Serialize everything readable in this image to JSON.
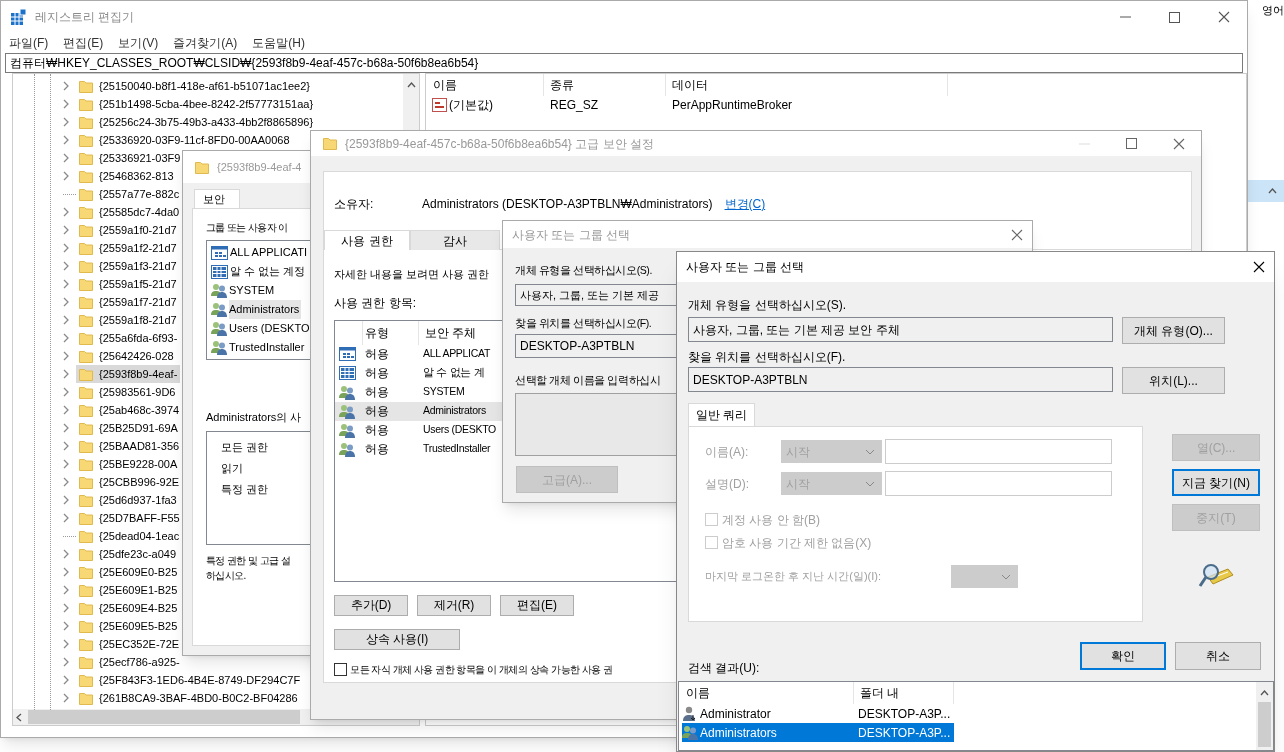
{
  "background_window": {
    "text": "영어"
  },
  "registry": {
    "title": "레지스트리 편집기",
    "menu": [
      "파일(F)",
      "편집(E)",
      "보기(V)",
      "즐겨찾기(A)",
      "도움말(H)"
    ],
    "address": "컴퓨터₩HKEY_CLASSES_ROOT₩CLSID₩{2593f8b9-4eaf-457c-b68a-50f6b8ea6b54}",
    "tree": [
      {
        "label": "{25150040-b8f1-418e-af61-b51071ac1ee2}",
        "expandable": true,
        "selected": false
      },
      {
        "label": "{251b1498-5cba-4bee-8242-2f57773151aa}",
        "expandable": true,
        "selected": false
      },
      {
        "label": "{25256c24-3b75-49b3-a433-4bb2f8865896}",
        "expandable": true,
        "selected": false
      },
      {
        "label": "{25336920-03F9-11cf-8FD0-00AA0068",
        "expandable": true,
        "selected": false
      },
      {
        "label": "{25336921-03F9",
        "expandable": true,
        "selected": false
      },
      {
        "label": "{25468362-813",
        "expandable": true,
        "selected": false
      },
      {
        "label": "{2557a77e-882c",
        "expandable": false,
        "selected": false
      },
      {
        "label": "{25585dc7-4da0",
        "expandable": true,
        "selected": false
      },
      {
        "label": "{2559a1f0-21d7",
        "expandable": true,
        "selected": false
      },
      {
        "label": "{2559a1f2-21d7",
        "expandable": true,
        "selected": false
      },
      {
        "label": "{2559a1f3-21d7",
        "expandable": true,
        "selected": false
      },
      {
        "label": "{2559a1f5-21d7",
        "expandable": true,
        "selected": false
      },
      {
        "label": "{2559a1f7-21d7",
        "expandable": true,
        "selected": false
      },
      {
        "label": "{2559a1f8-21d7",
        "expandable": true,
        "selected": false
      },
      {
        "label": "{255a6fda-6f93-",
        "expandable": true,
        "selected": false
      },
      {
        "label": "{25642426-028",
        "expandable": true,
        "selected": false
      },
      {
        "label": "{2593f8b9-4eaf-",
        "expandable": true,
        "selected": true
      },
      {
        "label": "{25983561-9D6",
        "expandable": true,
        "selected": false
      },
      {
        "label": "{25ab468c-3974",
        "expandable": true,
        "selected": false
      },
      {
        "label": "{25B25D91-69A",
        "expandable": true,
        "selected": false
      },
      {
        "label": "{25BAAD81-356",
        "expandable": true,
        "selected": false
      },
      {
        "label": "{25BE9228-00A",
        "expandable": true,
        "selected": false
      },
      {
        "label": "{25CBB996-92E",
        "expandable": true,
        "selected": false
      },
      {
        "label": "{25d6d937-1fa3",
        "expandable": true,
        "selected": false
      },
      {
        "label": "{25D7BAFF-F55",
        "expandable": true,
        "selected": false
      },
      {
        "label": "{25dead04-1eac",
        "expandable": false,
        "selected": false
      },
      {
        "label": "{25dfe23c-a049",
        "expandable": true,
        "selected": false
      },
      {
        "label": "{25E609E0-B25",
        "expandable": true,
        "selected": false
      },
      {
        "label": "{25E609E1-B25",
        "expandable": true,
        "selected": false
      },
      {
        "label": "{25E609E4-B25",
        "expandable": true,
        "selected": false
      },
      {
        "label": "{25E609E5-B25",
        "expandable": true,
        "selected": false
      },
      {
        "label": "{25EC352E-72E",
        "expandable": true,
        "selected": false
      },
      {
        "label": "{25ecf786-a925-",
        "expandable": true,
        "selected": false
      },
      {
        "label": "{25F843F3-1ED6-4B4E-8749-DF294C7F",
        "expandable": true,
        "selected": false
      },
      {
        "label": "{261B8CA9-3BAF-4BD0-B0C2-BF04286",
        "expandable": true,
        "selected": false
      }
    ],
    "values": {
      "columns": [
        "이름",
        "종류",
        "데이터"
      ],
      "rows": [
        {
          "name": "(기본값)",
          "type": "REG_SZ",
          "data": "PerAppRuntimeBroker"
        }
      ]
    }
  },
  "security_dialog": {
    "title": "{2593f8b9-4eaf-4",
    "tabs": [
      {
        "label": "보안",
        "selected": true
      }
    ],
    "groups_label": "그룹 또는 사용자 이",
    "principals": [
      {
        "name": "ALL APPLICATI",
        "kind": "package",
        "selected": false
      },
      {
        "name": "알 수 없는 계정",
        "kind": "unknown",
        "selected": false
      },
      {
        "name": "SYSTEM",
        "kind": "group",
        "selected": false
      },
      {
        "name": "Administrators",
        "kind": "group",
        "selected": true
      },
      {
        "name": "Users (DESKTO",
        "kind": "group",
        "selected": false
      },
      {
        "name": "TrustedInstaller",
        "kind": "group",
        "selected": false
      }
    ],
    "permissions_label": "Administrators의 사",
    "permissions": [
      "모든 권한",
      "읽기",
      "특정 권한"
    ],
    "note_lines": [
      "특정 권한 및 고급 설",
      "하십시오."
    ]
  },
  "advanced_dialog": {
    "title": "{2593f8b9-4eaf-457c-b68a-50f6b8ea6b54} 고급 보안 설정",
    "owner_label": "소유자:",
    "owner": "Administrators (DESKTOP-A3PTBLN₩Administrators)",
    "change_link": "변경(C)",
    "tabs": [
      {
        "label": "사용 권한",
        "selected": true
      },
      {
        "label": "감사",
        "selected": false
      }
    ],
    "hint": "자세한 내용을 보려면 사용 권한",
    "entries_label": "사용 권한 항목:",
    "columns": [
      "유형",
      "보안 주체"
    ],
    "entries": [
      {
        "type": "허용",
        "principal": "ALL APPLICAT",
        "kind": "package",
        "selected": false
      },
      {
        "type": "허용",
        "principal": "알 수 없는 계",
        "kind": "unknown",
        "selected": false
      },
      {
        "type": "허용",
        "principal": "SYSTEM",
        "kind": "group",
        "selected": false
      },
      {
        "type": "허용",
        "principal": "Administrators",
        "kind": "group",
        "selected": true
      },
      {
        "type": "허용",
        "principal": "Users (DESKTO",
        "kind": "group",
        "selected": false
      },
      {
        "type": "허용",
        "principal": "TrustedInstaller",
        "kind": "group",
        "selected": false
      }
    ],
    "buttons": [
      "추가(D)",
      "제거(R)",
      "편집(E)"
    ],
    "inherit_button": "상속 사용(I)",
    "inherit_checkbox": {
      "label": "모든 자식 개체 사용 권한 항목을 이 개체의 상속 가능한 사용 권",
      "checked": false
    }
  },
  "select_dialog_back": {
    "title": "사용자 또는 그룹 선택",
    "object_type_label": "개체 유형을 선택하십시오(S).",
    "object_type": "사용자, 그룹, 또는 기본 제공",
    "location_label": "찾을 위치를 선택하십시오(F).",
    "location": "DESKTOP-A3PTBLN",
    "names_label": "선택할 개체 이름을 입력하십시",
    "advanced_button": {
      "label": "고급(A)...",
      "disabled": true
    }
  },
  "select_dialog": {
    "title": "사용자 또는 그룹 선택",
    "object_type_label": "개체 유형을 선택하십시오(S).",
    "object_type": "사용자, 그룹, 또는 기본 제공 보안 주체",
    "object_types_button": "개체 유형(O)...",
    "location_label": "찾을 위치를 선택하십시오(F).",
    "location": "DESKTOP-A3PTBLN",
    "locations_button": "위치(L)...",
    "tabs": [
      {
        "label": "일반 쿼리",
        "selected": true
      }
    ],
    "query_disabled": true,
    "query_fields": [
      {
        "label": "이름(A):",
        "operator": "시작"
      },
      {
        "label": "설명(D):",
        "operator": "시작"
      }
    ],
    "checkboxes": [
      {
        "label": "계정 사용 안 함(B)",
        "checked": false
      },
      {
        "label": "암호 사용 기간 제한 없음(X)",
        "checked": false
      }
    ],
    "last_logon_label": "마지막 로그온한 후 지난 시간(일)(I):",
    "side_buttons": [
      {
        "label": "열(C)...",
        "disabled": true,
        "default": false
      },
      {
        "label": "지금 찾기(N)",
        "disabled": false,
        "default": true
      },
      {
        "label": "중지(T)",
        "disabled": true,
        "default": false
      }
    ],
    "ok_button": {
      "label": "확인",
      "default": true
    },
    "cancel_button": "취소",
    "results_label": "검색 결과(U):",
    "results": {
      "columns": [
        "이름",
        "폴더 내"
      ],
      "rows": [
        {
          "name": "Administrator",
          "folder": "DESKTOP-A3P...",
          "kind": "user",
          "selected": false
        },
        {
          "name": "Administrators",
          "folder": "DESKTOP-A3P...",
          "kind": "group",
          "selected": true
        }
      ]
    }
  }
}
